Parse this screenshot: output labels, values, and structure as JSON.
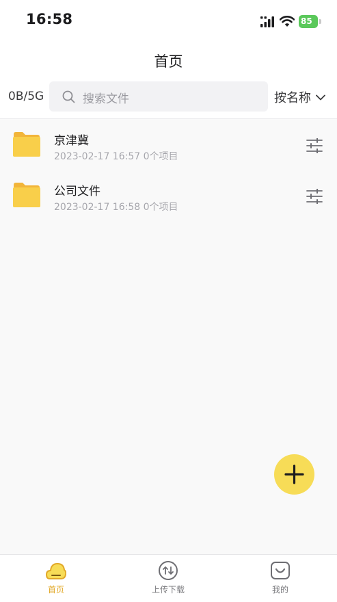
{
  "status_bar": {
    "time": "16:58",
    "battery": "85"
  },
  "header": {
    "title": "首页"
  },
  "toolbar": {
    "storage": "0B/5G",
    "search_placeholder": "搜索文件",
    "sort_label": "按名称"
  },
  "files": [
    {
      "name": "京津冀",
      "meta": "2023-02-17 16:57 0个项目"
    },
    {
      "name": "公司文件",
      "meta": "2023-02-17 16:58 0个项目"
    }
  ],
  "tabs": [
    {
      "label": "首页",
      "icon": "home-cloud-icon",
      "active": true
    },
    {
      "label": "上传下载",
      "icon": "transfer-icon",
      "active": false
    },
    {
      "label": "我的",
      "icon": "profile-icon",
      "active": false
    }
  ],
  "colors": {
    "accent": "#f7dc57",
    "active_tab": "#e2a929",
    "folder": "#f9cf4a",
    "battery": "#5ac85a"
  }
}
